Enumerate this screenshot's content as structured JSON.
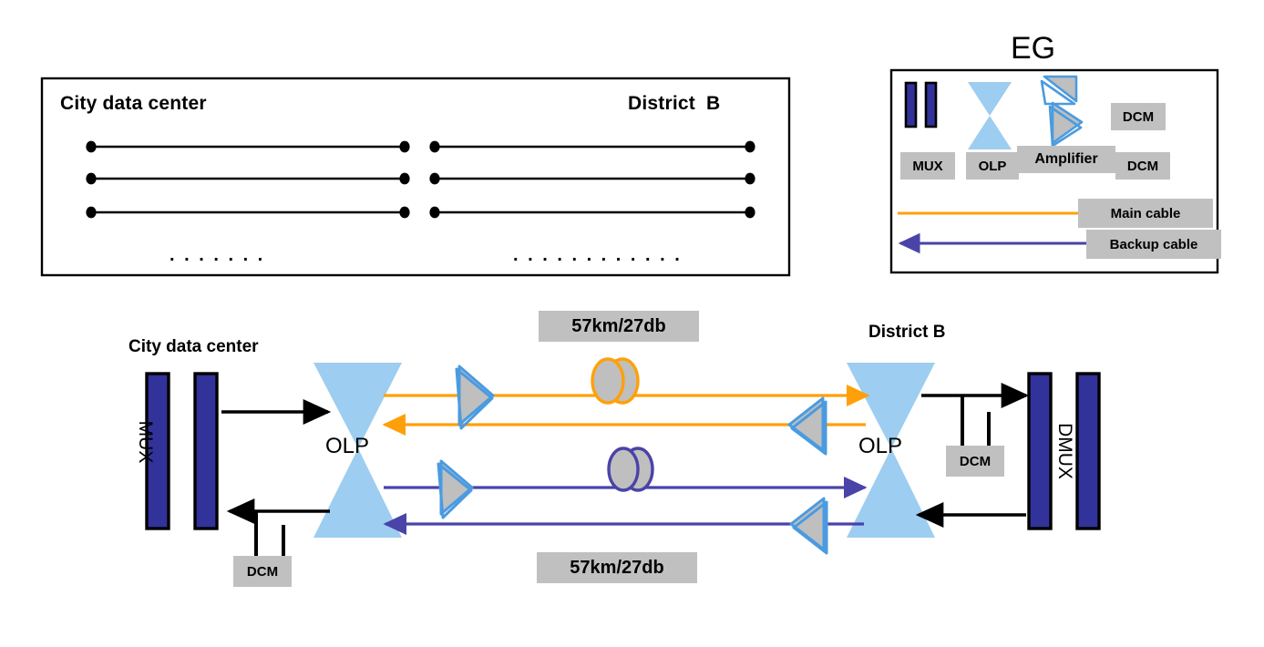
{
  "topology_box": {
    "left_title": "City data center",
    "right_title": "District  B",
    "left_ellipsis": ". . . . . . .",
    "right_ellipsis": ". . . . . . . . . . . .",
    "left_link_count": 3,
    "right_link_count": 3
  },
  "legend": {
    "title": "EG",
    "items": [
      {
        "label": "MUX",
        "icon": "mux-bars-icon"
      },
      {
        "label": "OLP",
        "icon": "bowtie-icon"
      },
      {
        "label": "Amplifier",
        "icon": "amplifier-triangles-icon"
      },
      {
        "label": "DCM",
        "icon": "dcm-box-icon"
      }
    ],
    "dcm_top_label": "DCM",
    "cables": [
      {
        "label": "Main cable",
        "color": "#FFA00A",
        "arrow": false
      },
      {
        "label": "Backup cable",
        "color": "#4A43A8",
        "arrow": true
      }
    ]
  },
  "main": {
    "left_site_title": "City data center",
    "right_site_title": "District B",
    "left_mux_label": "MUX",
    "right_mux_label": "DMUX",
    "left_olp_label": "OLP",
    "right_olp_label": "OLP",
    "left_dcm_label": "DCM",
    "right_dcm_label": "DCM",
    "span_label_top": "57km/27db",
    "span_label_bottom": "57km/27db",
    "links": [
      {
        "name": "main-cable-forward",
        "color": "#FFA00A",
        "direction": "right"
      },
      {
        "name": "main-cable-reverse",
        "color": "#FFA00A",
        "direction": "left"
      },
      {
        "name": "backup-cable-forward",
        "color": "#4A43A8",
        "direction": "right"
      },
      {
        "name": "backup-cable-reverse",
        "color": "#4A43A8",
        "direction": "left"
      }
    ]
  },
  "colors": {
    "mux_fill": "#32329B",
    "olp_fill": "#9DCDF0",
    "amp_fill": "#BFBFBF",
    "amp_stroke": "#4A9BE0",
    "gray_box": "#C0C0C0",
    "main_cable": "#FFA00A",
    "backup_cable": "#4A43A8",
    "outline": "#000000"
  }
}
